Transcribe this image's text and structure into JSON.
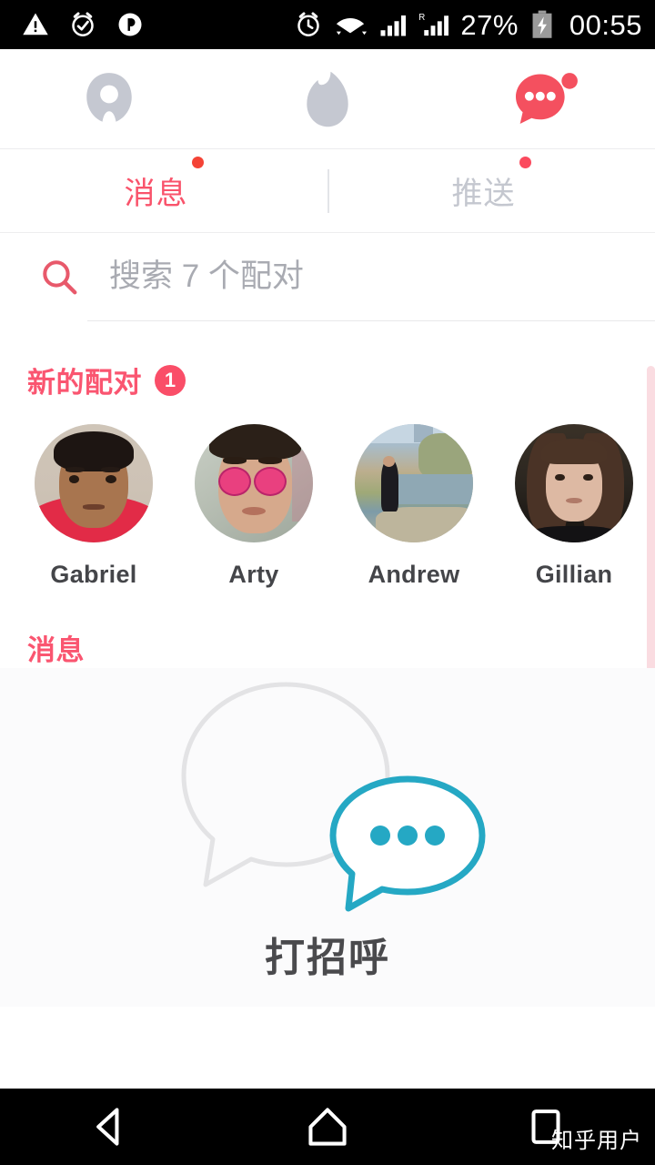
{
  "status_bar": {
    "left_icons": [
      "warning-triangle-icon",
      "alarm-clock-icon",
      "parking-p-icon"
    ],
    "right_icons": [
      "alarm-clock-icon",
      "wifi-icon",
      "signal-bars-icon",
      "roaming-signal-icon"
    ],
    "roaming_label": "R",
    "battery_percent": "27%",
    "battery_state": "charging",
    "clock": "00:55"
  },
  "top_nav": {
    "items": [
      {
        "name": "profile-icon",
        "active": false
      },
      {
        "name": "flame-icon",
        "active": false
      },
      {
        "name": "messages-icon",
        "active": true,
        "has_badge": true
      }
    ]
  },
  "tabs": [
    {
      "label": "消息",
      "active": true,
      "has_dot": true
    },
    {
      "label": "推送",
      "active": false,
      "has_dot": true
    }
  ],
  "search": {
    "icon": "search-icon",
    "placeholder": "搜索 7 个配对",
    "value": ""
  },
  "new_matches": {
    "title": "新的配对",
    "badge": "1",
    "items": [
      {
        "name": "Gabriel"
      },
      {
        "name": "Arty"
      },
      {
        "name": "Andrew"
      },
      {
        "name": "Gillian"
      }
    ]
  },
  "messages": {
    "title": "消息",
    "empty_state": {
      "cta": "打招呼",
      "illustration": "speech-bubbles-icon",
      "large_bubble_color": "#e3e3e5",
      "small_bubble_color": "#25a8c4"
    }
  },
  "android_nav": {
    "back": "back-triangle-icon",
    "home": "home-icon",
    "recents": "recents-square-icon",
    "watermark": "知乎用户"
  },
  "colors": {
    "accent_red": "#f9536b",
    "badge_red": "#fa4e68",
    "inactive_gray": "#c4c7cf",
    "teal": "#25a8c4",
    "scrollbar_pink": "#fadce1"
  }
}
